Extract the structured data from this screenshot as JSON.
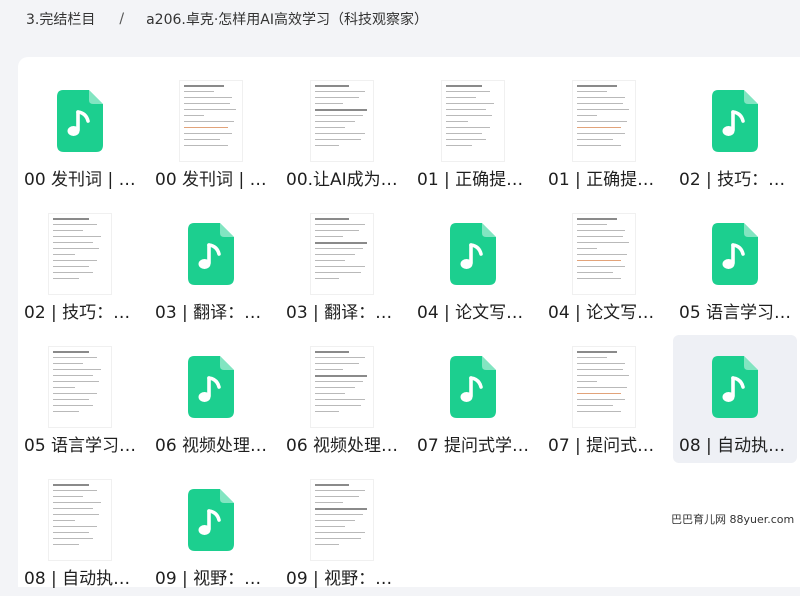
{
  "breadcrumb": {
    "parent": "3.完结栏目",
    "separator": "/",
    "current": "a206.卓克·怎样用AI高效学习（科技观察家）"
  },
  "watermark": "巴巴育儿网 88yuer.com",
  "files": [
    {
      "label": "00 发刊词 | …",
      "type": "audio"
    },
    {
      "label": "00 发刊词 | …",
      "type": "doc"
    },
    {
      "label": "00.让AI成为…",
      "type": "doc"
    },
    {
      "label": "01 | 正确提…",
      "type": "doc"
    },
    {
      "label": "01 | 正确提…",
      "type": "doc"
    },
    {
      "label": "02 | 技巧：…",
      "type": "audio"
    },
    {
      "label": "02 | 技巧：…",
      "type": "doc"
    },
    {
      "label": "03 | 翻译：…",
      "type": "audio"
    },
    {
      "label": "03 | 翻译：…",
      "type": "doc"
    },
    {
      "label": "04 | 论文写…",
      "type": "audio"
    },
    {
      "label": "04 | 论文写…",
      "type": "doc"
    },
    {
      "label": "05 语言学习…",
      "type": "audio"
    },
    {
      "label": "05 语言学习…",
      "type": "doc"
    },
    {
      "label": "06 视频处理…",
      "type": "audio"
    },
    {
      "label": "06 视频处理…",
      "type": "doc"
    },
    {
      "label": "07 提问式学…",
      "type": "audio"
    },
    {
      "label": "07 | 提问式…",
      "type": "doc"
    },
    {
      "label": "08 | 自动执…",
      "type": "audio",
      "selected": true
    },
    {
      "label": "08 | 自动执…",
      "type": "doc"
    },
    {
      "label": "09 | 视野：…",
      "type": "audio"
    },
    {
      "label": "09 | 视野：…",
      "type": "doc"
    }
  ],
  "colors": {
    "audio_icon": "#1ccf8f",
    "background": "#f3f4f7",
    "panel": "#ffffff"
  }
}
